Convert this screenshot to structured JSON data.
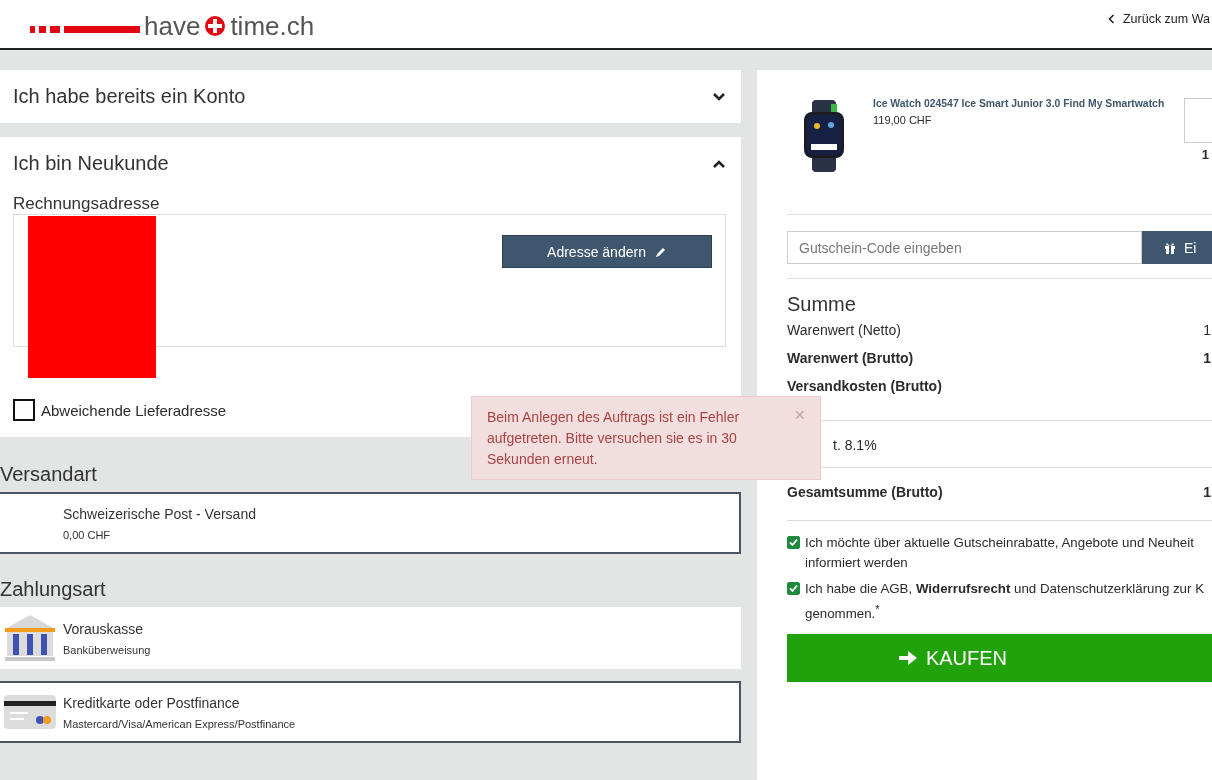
{
  "header": {
    "logo_left": "have",
    "logo_right": "time.ch",
    "back_link": "Zurück zum Wa"
  },
  "account_sections": [
    {
      "title": "Ich habe bereits ein Konto",
      "expanded": false
    },
    {
      "title": "Ich bin Neukunde",
      "expanded": true
    }
  ],
  "billing": {
    "title": "Rechnungsadresse",
    "edit_button": "Adresse ändern",
    "alt_delivery": {
      "label": "Abweichende Lieferadresse",
      "checked": false
    }
  },
  "shipping": {
    "title": "Versandart",
    "options": [
      {
        "name": "Schweizerische Post - Versand",
        "detail": "0,00 CHF",
        "selected": true
      }
    ]
  },
  "payment": {
    "title": "Zahlungsart",
    "options": [
      {
        "kind": "bank",
        "name": "Vorauskasse",
        "detail": "Banküberweisung",
        "selected": false
      },
      {
        "kind": "card",
        "name": "Kreditkarte oder Postfinance",
        "detail": "Mastercard/Visa/American Express/Postfinance",
        "selected": true
      }
    ]
  },
  "error_toast": {
    "message": "Beim Anlegen des Auftrags ist ein Fehler aufgetreten. Bitte versuchen sie es in 30 Sekunden erneut.",
    "close": "×"
  },
  "cart": {
    "item": {
      "name": "Ice Watch 024547 Ice Smart Junior 3.0 Find My Smartwatch",
      "price": "119,00 CHF",
      "total": "1"
    },
    "voucher": {
      "placeholder": "Gutschein-Code eingeben",
      "button": "Ei"
    },
    "summary_title": "Summe",
    "rows": [
      {
        "label": "Warenwert (Netto)",
        "value": "1",
        "bold": false
      },
      {
        "label": "Warenwert (Brutto)",
        "value": "1",
        "bold": true
      },
      {
        "label": "Versandkosten (Brutto)",
        "value": "",
        "bold": true
      }
    ],
    "tax": "t. 8.1%",
    "total": {
      "label": "Gesamtsumme (Brutto)",
      "value": "1"
    },
    "consents": [
      {
        "lines": [
          "Ich möchte über aktuelle Gutscheinrabatte, Angebote und Neuheit",
          "informiert werden"
        ],
        "checked": true
      },
      {
        "lines": [
          "Ich habe die AGB, **Widerrufsrecht** und Datenschutzerklärung zur K",
          "genommen.$^{*}$"
        ],
        "checked": true
      }
    ],
    "buy_button": "KAUFEN"
  }
}
